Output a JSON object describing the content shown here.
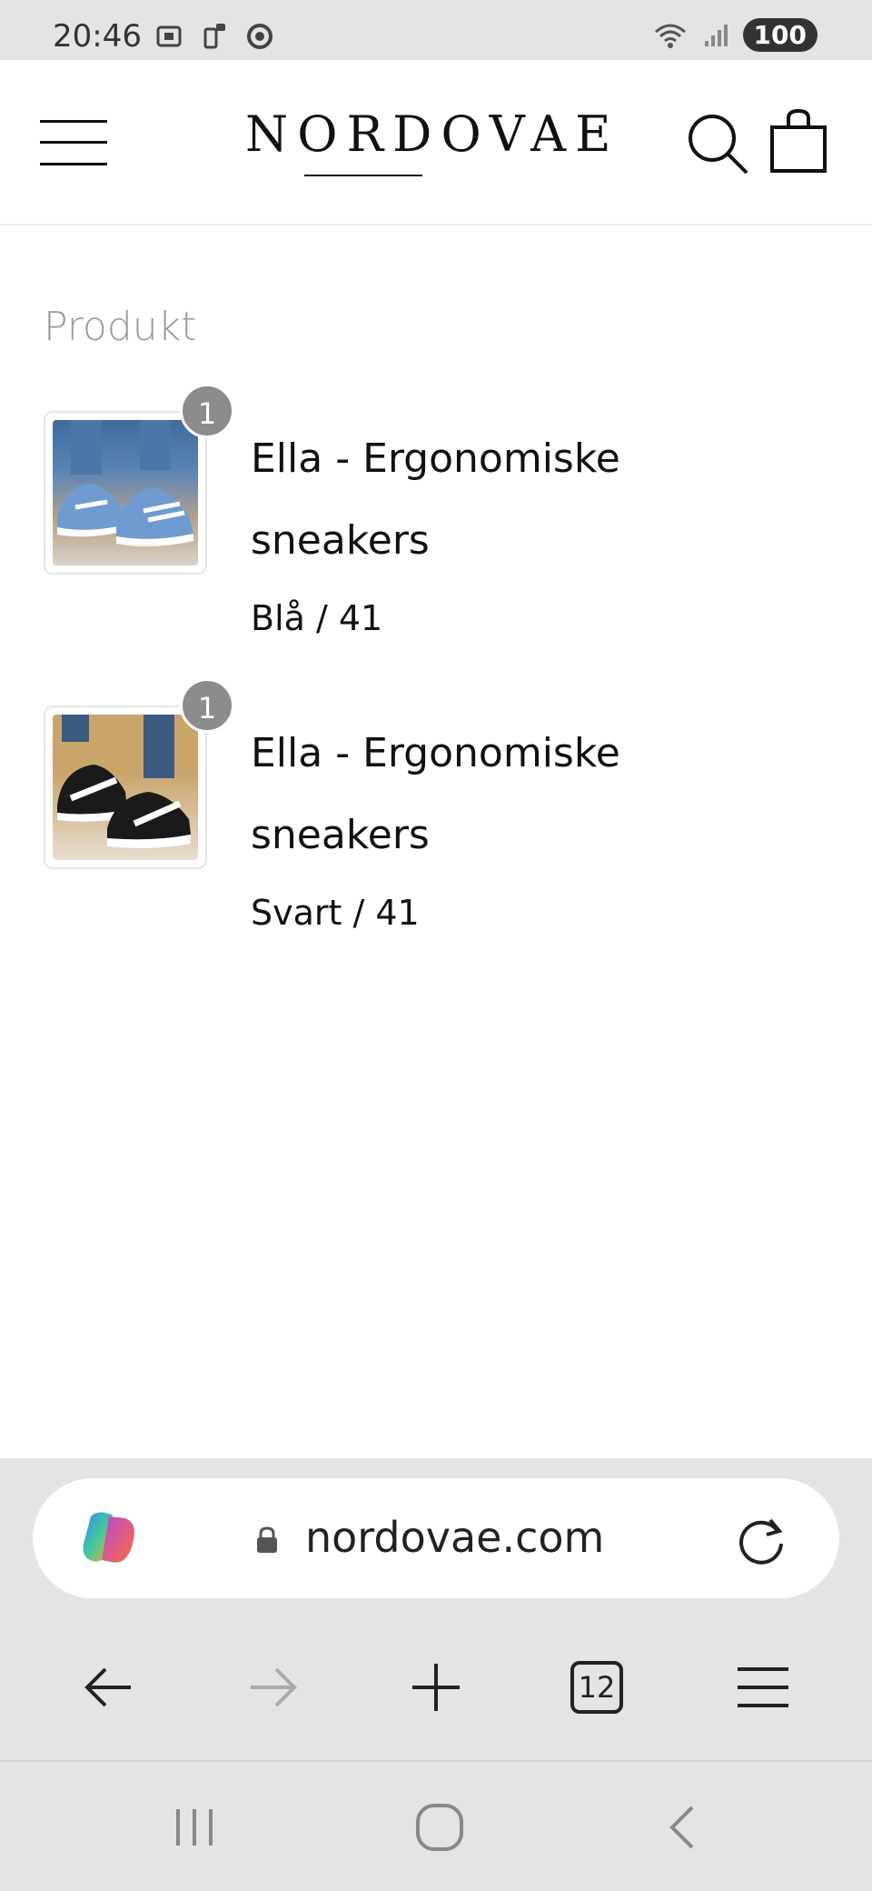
{
  "status_bar": {
    "time": "20:46",
    "battery": "100",
    "icons": [
      "screenshot-icon",
      "sim-icon",
      "chrome-icon",
      "wifi-icon",
      "signal-icon"
    ]
  },
  "header": {
    "brand": "NORDOVAE",
    "icons": [
      "menu-icon",
      "search-icon",
      "cart-icon"
    ]
  },
  "section": {
    "title": "Produkt"
  },
  "products": [
    {
      "quantity": "1",
      "name": "Ella - Ergonomiske sneakers",
      "variant": "Blå / 41",
      "image": "blue-sneakers"
    },
    {
      "quantity": "1",
      "name": "Ella - Ergonomiske sneakers",
      "variant": "Svart / 41",
      "image": "black-sneakers"
    }
  ],
  "browser": {
    "url": "nordovae.com",
    "tab_count": "12",
    "icons": [
      "copilot-icon",
      "lock-icon",
      "reload-icon",
      "back-icon",
      "forward-icon",
      "new-tab-icon",
      "tabs-icon",
      "menu-icon"
    ]
  },
  "colors": {
    "chrome_bg": "#e4e4e6",
    "badge": "#8c8c8c",
    "muted_text": "#9a9a9a"
  }
}
